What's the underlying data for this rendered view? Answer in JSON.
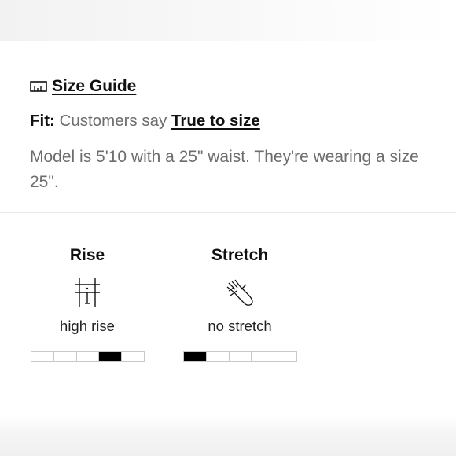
{
  "size_guide": {
    "label": "Size Guide",
    "icon": "ruler-icon"
  },
  "fit": {
    "label": "Fit:",
    "text": "Customers say",
    "link": "True to size"
  },
  "model_info": "Model is 5'10 with a 25\" waist. They're wearing a size 25\".",
  "attributes": [
    {
      "title": "Rise",
      "icon": "rise-icon",
      "value": "high rise",
      "level": 4,
      "max": 5
    },
    {
      "title": "Stretch",
      "icon": "stretch-icon",
      "value": "no stretch",
      "level": 1,
      "max": 5
    }
  ]
}
